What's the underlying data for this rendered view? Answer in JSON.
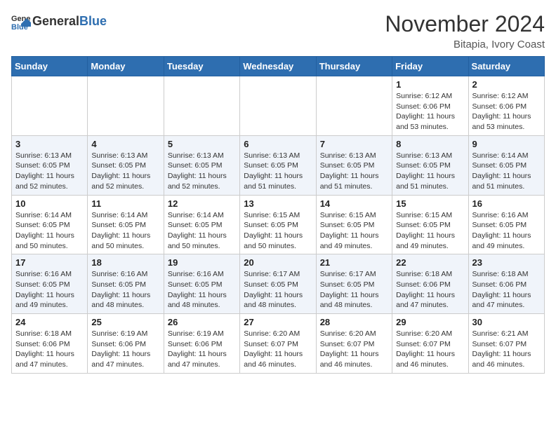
{
  "logo": {
    "general": "General",
    "blue": "Blue"
  },
  "header": {
    "title": "November 2024",
    "subtitle": "Bitapia, Ivory Coast"
  },
  "weekdays": [
    "Sunday",
    "Monday",
    "Tuesday",
    "Wednesday",
    "Thursday",
    "Friday",
    "Saturday"
  ],
  "weeks": [
    [
      {
        "day": "",
        "info": ""
      },
      {
        "day": "",
        "info": ""
      },
      {
        "day": "",
        "info": ""
      },
      {
        "day": "",
        "info": ""
      },
      {
        "day": "",
        "info": ""
      },
      {
        "day": "1",
        "info": "Sunrise: 6:12 AM\nSunset: 6:06 PM\nDaylight: 11 hours\nand 53 minutes."
      },
      {
        "day": "2",
        "info": "Sunrise: 6:12 AM\nSunset: 6:06 PM\nDaylight: 11 hours\nand 53 minutes."
      }
    ],
    [
      {
        "day": "3",
        "info": "Sunrise: 6:13 AM\nSunset: 6:05 PM\nDaylight: 11 hours\nand 52 minutes."
      },
      {
        "day": "4",
        "info": "Sunrise: 6:13 AM\nSunset: 6:05 PM\nDaylight: 11 hours\nand 52 minutes."
      },
      {
        "day": "5",
        "info": "Sunrise: 6:13 AM\nSunset: 6:05 PM\nDaylight: 11 hours\nand 52 minutes."
      },
      {
        "day": "6",
        "info": "Sunrise: 6:13 AM\nSunset: 6:05 PM\nDaylight: 11 hours\nand 51 minutes."
      },
      {
        "day": "7",
        "info": "Sunrise: 6:13 AM\nSunset: 6:05 PM\nDaylight: 11 hours\nand 51 minutes."
      },
      {
        "day": "8",
        "info": "Sunrise: 6:13 AM\nSunset: 6:05 PM\nDaylight: 11 hours\nand 51 minutes."
      },
      {
        "day": "9",
        "info": "Sunrise: 6:14 AM\nSunset: 6:05 PM\nDaylight: 11 hours\nand 51 minutes."
      }
    ],
    [
      {
        "day": "10",
        "info": "Sunrise: 6:14 AM\nSunset: 6:05 PM\nDaylight: 11 hours\nand 50 minutes."
      },
      {
        "day": "11",
        "info": "Sunrise: 6:14 AM\nSunset: 6:05 PM\nDaylight: 11 hours\nand 50 minutes."
      },
      {
        "day": "12",
        "info": "Sunrise: 6:14 AM\nSunset: 6:05 PM\nDaylight: 11 hours\nand 50 minutes."
      },
      {
        "day": "13",
        "info": "Sunrise: 6:15 AM\nSunset: 6:05 PM\nDaylight: 11 hours\nand 50 minutes."
      },
      {
        "day": "14",
        "info": "Sunrise: 6:15 AM\nSunset: 6:05 PM\nDaylight: 11 hours\nand 49 minutes."
      },
      {
        "day": "15",
        "info": "Sunrise: 6:15 AM\nSunset: 6:05 PM\nDaylight: 11 hours\nand 49 minutes."
      },
      {
        "day": "16",
        "info": "Sunrise: 6:16 AM\nSunset: 6:05 PM\nDaylight: 11 hours\nand 49 minutes."
      }
    ],
    [
      {
        "day": "17",
        "info": "Sunrise: 6:16 AM\nSunset: 6:05 PM\nDaylight: 11 hours\nand 49 minutes."
      },
      {
        "day": "18",
        "info": "Sunrise: 6:16 AM\nSunset: 6:05 PM\nDaylight: 11 hours\nand 48 minutes."
      },
      {
        "day": "19",
        "info": "Sunrise: 6:16 AM\nSunset: 6:05 PM\nDaylight: 11 hours\nand 48 minutes."
      },
      {
        "day": "20",
        "info": "Sunrise: 6:17 AM\nSunset: 6:05 PM\nDaylight: 11 hours\nand 48 minutes."
      },
      {
        "day": "21",
        "info": "Sunrise: 6:17 AM\nSunset: 6:05 PM\nDaylight: 11 hours\nand 48 minutes."
      },
      {
        "day": "22",
        "info": "Sunrise: 6:18 AM\nSunset: 6:06 PM\nDaylight: 11 hours\nand 47 minutes."
      },
      {
        "day": "23",
        "info": "Sunrise: 6:18 AM\nSunset: 6:06 PM\nDaylight: 11 hours\nand 47 minutes."
      }
    ],
    [
      {
        "day": "24",
        "info": "Sunrise: 6:18 AM\nSunset: 6:06 PM\nDaylight: 11 hours\nand 47 minutes."
      },
      {
        "day": "25",
        "info": "Sunrise: 6:19 AM\nSunset: 6:06 PM\nDaylight: 11 hours\nand 47 minutes."
      },
      {
        "day": "26",
        "info": "Sunrise: 6:19 AM\nSunset: 6:06 PM\nDaylight: 11 hours\nand 47 minutes."
      },
      {
        "day": "27",
        "info": "Sunrise: 6:20 AM\nSunset: 6:07 PM\nDaylight: 11 hours\nand 46 minutes."
      },
      {
        "day": "28",
        "info": "Sunrise: 6:20 AM\nSunset: 6:07 PM\nDaylight: 11 hours\nand 46 minutes."
      },
      {
        "day": "29",
        "info": "Sunrise: 6:20 AM\nSunset: 6:07 PM\nDaylight: 11 hours\nand 46 minutes."
      },
      {
        "day": "30",
        "info": "Sunrise: 6:21 AM\nSunset: 6:07 PM\nDaylight: 11 hours\nand 46 minutes."
      }
    ]
  ]
}
